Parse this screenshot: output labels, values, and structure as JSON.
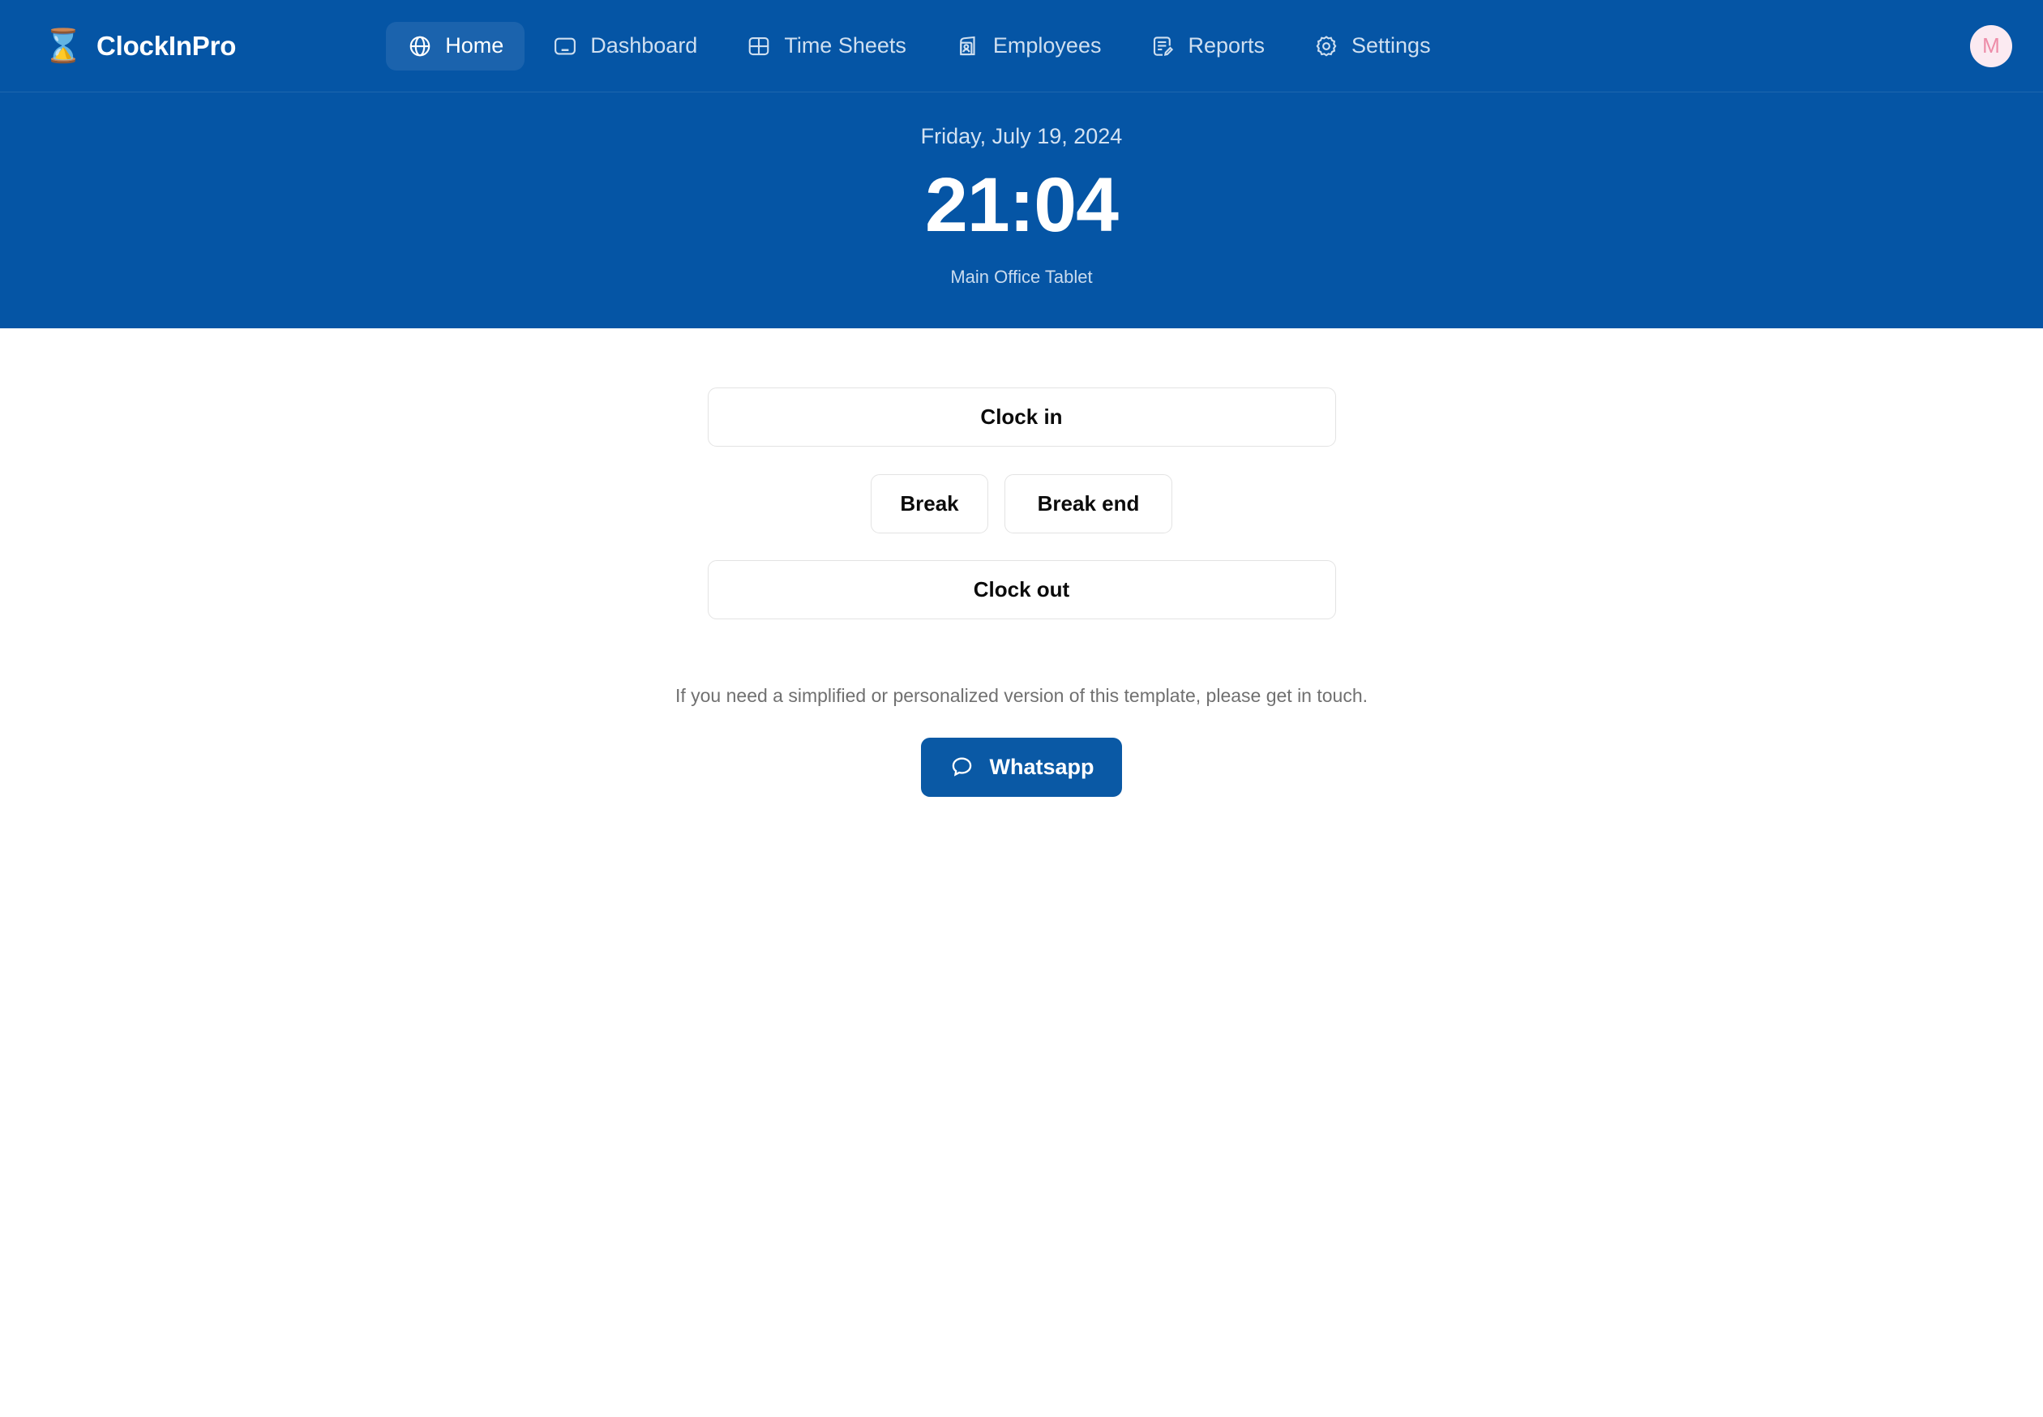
{
  "app": {
    "name": "ClockInPro",
    "logo_icon": "watch-icon",
    "brand_color": "#0555a5",
    "active_nav_color": "#1b63ad"
  },
  "nav": {
    "items": [
      {
        "label": "Home",
        "icon": "globe-icon",
        "active": true
      },
      {
        "label": "Dashboard",
        "icon": "monitor-icon",
        "active": false
      },
      {
        "label": "Time Sheets",
        "icon": "table-icon",
        "active": false
      },
      {
        "label": "Employees",
        "icon": "id-badge-icon",
        "active": false
      },
      {
        "label": "Reports",
        "icon": "document-pencil-icon",
        "active": false
      },
      {
        "label": "Settings",
        "icon": "gear-icon",
        "active": false
      }
    ],
    "avatar": {
      "initial": "M",
      "bg_color": "#fbeaf1",
      "text_color": "#ed8ca8"
    }
  },
  "hero": {
    "date": "Friday, July 19, 2024",
    "time": "21:04",
    "location": "Main Office Tablet"
  },
  "actions": {
    "clock_in": "Clock in",
    "break_start": "Break",
    "break_end": "Break end",
    "clock_out": "Clock out"
  },
  "footer": {
    "note": "If you need a simplified or personalized version of this template, please get in touch.",
    "whatsapp_label": "Whatsapp",
    "whatsapp_icon": "chat-bubble-icon",
    "whatsapp_color": "#0a59a5"
  }
}
